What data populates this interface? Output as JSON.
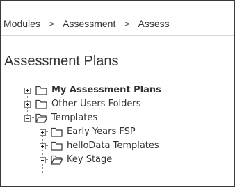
{
  "breadcrumb": {
    "items": [
      "Modules",
      "Assessment",
      "Assess"
    ],
    "separator": ">"
  },
  "page": {
    "title": "Assessment Plans"
  },
  "tree": {
    "items": [
      {
        "label": "My Assessment Plans",
        "bold": true,
        "expanded": false,
        "depth": 0
      },
      {
        "label": "Other Users Folders",
        "bold": false,
        "expanded": false,
        "depth": 0
      },
      {
        "label": "Templates",
        "bold": false,
        "expanded": true,
        "depth": 0
      },
      {
        "label": "Early Years FSP",
        "bold": false,
        "expanded": false,
        "depth": 1
      },
      {
        "label": "helloData Templates",
        "bold": false,
        "expanded": false,
        "depth": 1
      },
      {
        "label": "Key Stage",
        "bold": false,
        "expanded": true,
        "depth": 1
      }
    ]
  },
  "colors": {
    "text": "#333333",
    "divider": "#d6d6d6",
    "icon_stroke": "#3c3c3c"
  }
}
